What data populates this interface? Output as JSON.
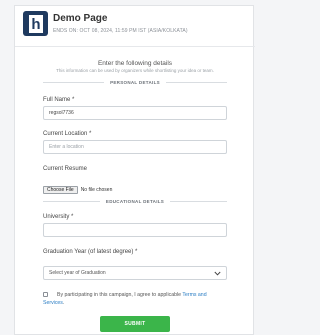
{
  "header": {
    "title": "Demo Page",
    "subtitle": "ENDS ON: OCT 08, 2024, 11:59 PM IST (ASIA/KOLKATA)",
    "logo_letter": "h",
    "logo_color": "#1f3a5f"
  },
  "intro": {
    "title": "Enter the following details",
    "subtitle": "This information can be used by organizers while shortlisting your idea or team."
  },
  "sections": {
    "personal": "PERSONAL DETAILS",
    "educational": "EDUCATIONAL DETAILS"
  },
  "fields": {
    "full_name": {
      "label": "Full Name *",
      "value": "regsol7736"
    },
    "current_location": {
      "label": "Current Location *",
      "placeholder": "Enter a location"
    },
    "current_resume": {
      "label": "Current Resume",
      "button": "Choose File",
      "status": "No file chosen"
    },
    "university": {
      "label": "University *",
      "value": ""
    },
    "graduation_year": {
      "label": "Graduation Year (of latest degree) *",
      "selected": "Select year of Graduation"
    }
  },
  "consent": {
    "text_before": "By participating in this campaign, I agree to applicable",
    "link_part1": "Terms and",
    "link_part2": "Services",
    "suffix": "."
  },
  "submit_label": "SUBMIT",
  "colors": {
    "accent_green": "#3bb54a",
    "link_blue": "#2a7dc4"
  }
}
